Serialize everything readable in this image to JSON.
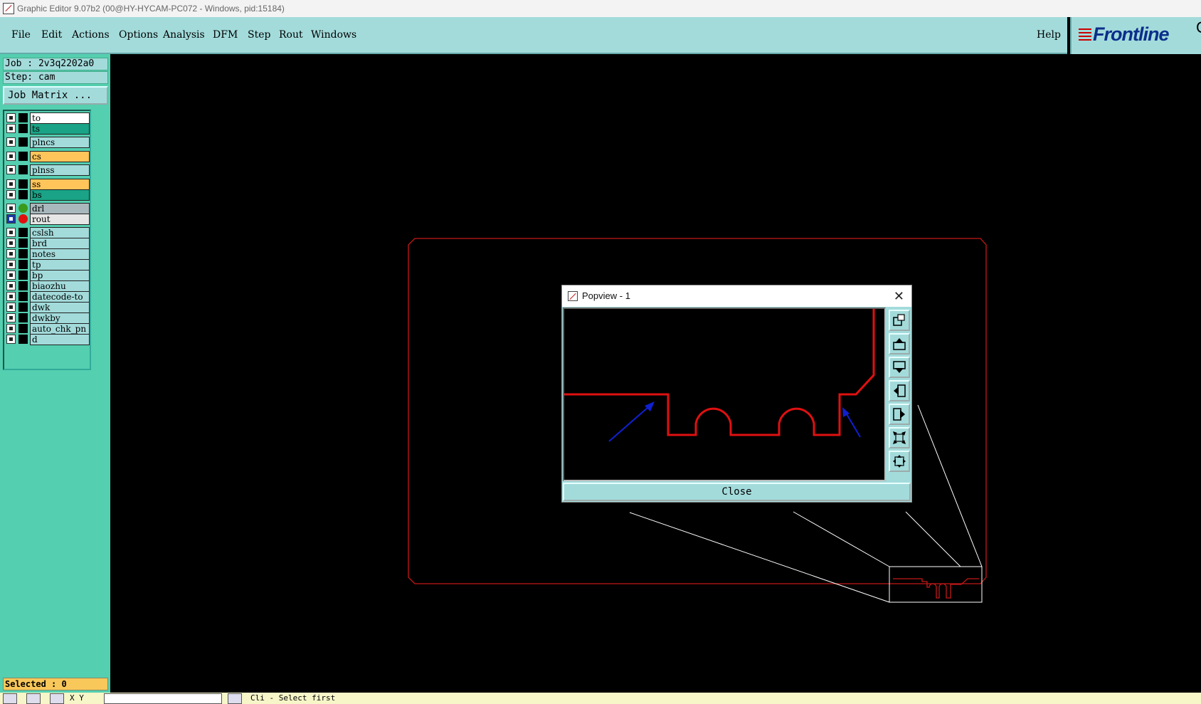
{
  "window": {
    "title": "Graphic Editor 9.07b2 (00@HY-HYCAM-PC072 - Windows, pid:15184)"
  },
  "menu": {
    "items": [
      "File",
      "Edit",
      "Actions",
      "Options",
      "Analysis",
      "DFM",
      "Step",
      "Rout",
      "Windows"
    ],
    "help": "Help"
  },
  "logo": {
    "text": "Frontline",
    "trailing": "G"
  },
  "panel": {
    "job": "Job : 2v3q2202a0",
    "step": "Step: cam",
    "job_matrix": "Job Matrix ...",
    "selected": "Selected : 0"
  },
  "layers": [
    {
      "name": "to",
      "color": "#ffffff",
      "mark": "square",
      "checked": false
    },
    {
      "name": "ts",
      "color": "#1aa386",
      "mark": "square",
      "checked": false
    },
    {
      "name": "plncs",
      "color": "#a3dbdb",
      "mark": "square",
      "checked": false
    },
    {
      "name": "cs",
      "color": "#ffc55a",
      "mark": "square",
      "checked": false
    },
    {
      "name": "plnss",
      "color": "#a3dbdb",
      "mark": "square",
      "checked": false
    },
    {
      "name": "ss",
      "color": "#ffc55a",
      "mark": "square",
      "checked": false
    },
    {
      "name": "bs",
      "color": "#1aa386",
      "mark": "square",
      "checked": false
    },
    {
      "name": "drl",
      "color": "#a8b8bc",
      "mark": "green-dot",
      "checked": false
    },
    {
      "name": "rout",
      "color": "#e6e6e6",
      "mark": "red-dot",
      "checked": true
    },
    {
      "name": "cslsh",
      "color": "#a3dbdb",
      "mark": "square",
      "checked": false
    },
    {
      "name": "brd",
      "color": "#a3dbdb",
      "mark": "square",
      "checked": false
    },
    {
      "name": "notes",
      "color": "#a3dbdb",
      "mark": "square",
      "checked": false
    },
    {
      "name": "tp",
      "color": "#a3dbdb",
      "mark": "square",
      "checked": false
    },
    {
      "name": "bp",
      "color": "#a3dbdb",
      "mark": "square",
      "checked": false
    },
    {
      "name": "biaozhu",
      "color": "#a3dbdb",
      "mark": "square",
      "checked": false
    },
    {
      "name": "datecode-to",
      "color": "#a3dbdb",
      "mark": "square",
      "checked": false
    },
    {
      "name": "dwk",
      "color": "#a3dbdb",
      "mark": "square",
      "checked": false
    },
    {
      "name": "dwkby",
      "color": "#a3dbdb",
      "mark": "square",
      "checked": false
    },
    {
      "name": "auto_chk_pn",
      "color": "#a3dbdb",
      "mark": "square",
      "checked": false
    },
    {
      "name": "d",
      "color": "#a3dbdb",
      "mark": "square",
      "checked": false
    }
  ],
  "status": {
    "xy_label": "X Y",
    "message": "Cli - Select first"
  },
  "popview": {
    "title": "Popview - 1",
    "close_label": "Close",
    "tools": [
      "zoom-window-icon",
      "pan-up-icon",
      "pan-down-icon",
      "pan-left-icon",
      "pan-right-icon",
      "zoom-out-icon",
      "fit-all-icon"
    ]
  },
  "colors": {
    "panel": "#54cfb0",
    "menubar": "#a3dbdb",
    "rout": "#e01010",
    "pointer_arrows": "#1020d0"
  }
}
